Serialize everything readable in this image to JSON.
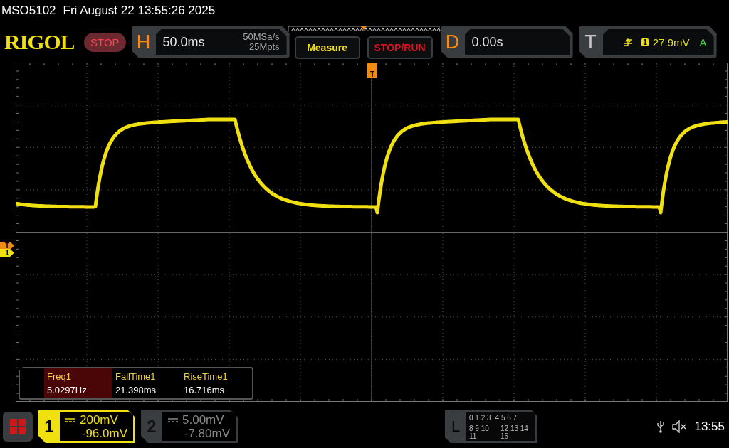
{
  "status_line": {
    "model": "MSO5102",
    "datetime": "Fri August 22 13:55:26 2025"
  },
  "toolbar": {
    "logo": "RIGOL",
    "run_state": "STOP",
    "horizontal": {
      "label": "H",
      "scale": "50.0ms",
      "sample_rate": "50MSa/s",
      "memory_depth": "25Mpts"
    },
    "measure_button": "Measure",
    "stop_run_button": "STOP/RUN",
    "delay": {
      "label": "D",
      "value": "0.00s"
    },
    "trigger": {
      "label": "T",
      "source": "1",
      "level": "27.9mV",
      "mode": "A"
    }
  },
  "markers": {
    "trigger_position": "T",
    "trigger_level": "T",
    "channel_1": "1"
  },
  "measurements": [
    {
      "name": "Freq1",
      "value": "5.0297Hz",
      "selected": true
    },
    {
      "name": "FallTime1",
      "value": "21.398ms",
      "selected": false
    },
    {
      "name": "RiseTime1",
      "value": "16.716ms",
      "selected": false
    }
  ],
  "channels": [
    {
      "number": "1",
      "scale": "200mV",
      "offset": "-96.0mV",
      "on": true
    },
    {
      "number": "2",
      "scale": "5.00mV",
      "offset": "-7.80mV",
      "on": false
    }
  ],
  "logic": {
    "label": "L",
    "rows": [
      [
        "0 1 2 3",
        "4 5 6 7"
      ],
      [
        "8 9 10 11",
        "12 13 14 15"
      ]
    ]
  },
  "status_bar": {
    "time": "13:55"
  }
}
